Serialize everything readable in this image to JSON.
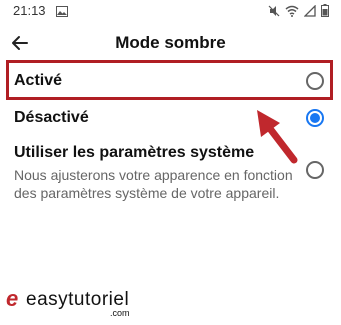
{
  "status_bar": {
    "time": "21:13"
  },
  "header": {
    "title": "Mode sombre"
  },
  "options": [
    {
      "label": "Activé",
      "selected": false
    },
    {
      "label": "Désactivé",
      "selected": true
    },
    {
      "label": "Utiliser les paramètres système",
      "description": "Nous ajusterons votre apparence en fonction des paramètres système de votre appareil.",
      "selected": false
    }
  ],
  "watermark": {
    "brand": "easytutoriel",
    "suffix": ".com"
  },
  "colors": {
    "accent": "#1877f2",
    "highlight": "#b01e23"
  }
}
